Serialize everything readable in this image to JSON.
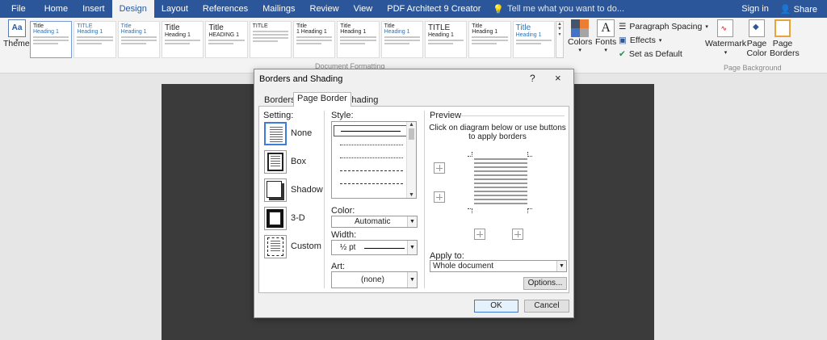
{
  "ribbon": {
    "tabs": [
      "File",
      "Home",
      "Insert",
      "Design",
      "Layout",
      "References",
      "Mailings",
      "Review",
      "View",
      "PDF Architect 9 Creator"
    ],
    "active_tab": "Design",
    "tell_me_placeholder": "Tell me what you want to do...",
    "sign_in": "Sign in",
    "share": "Share",
    "themes_label": "Themes",
    "style_thumbs": [
      {
        "title": "Title",
        "heading": "Heading 1"
      },
      {
        "title": "TITLE",
        "heading": "Heading 1"
      },
      {
        "title": "Title",
        "heading": "Heading 1"
      },
      {
        "title": "Title",
        "heading": "Heading 1"
      },
      {
        "title": "Title",
        "heading": "HEADING 1"
      },
      {
        "title": "TITLE",
        "heading": ""
      },
      {
        "title": "Title",
        "heading": "1 Heading 1"
      },
      {
        "title": "Title",
        "heading": "Heading 1"
      },
      {
        "title": "Title",
        "heading": "Heading 1"
      },
      {
        "title": "TITLE",
        "heading": "Heading 1"
      },
      {
        "title": "Title",
        "heading": "Heading 1"
      },
      {
        "title": "Title",
        "heading": "Heading 1"
      }
    ],
    "document_formatting_label": "Document Formatting",
    "colors_label": "Colors",
    "fonts_label": "Fonts",
    "paragraph_spacing": "Paragraph Spacing",
    "effects": "Effects",
    "set_as_default": "Set as Default",
    "watermark": "Watermark",
    "page_color": "Page Color",
    "page_borders": "Page Borders",
    "page_background_label": "Page Background"
  },
  "dialog": {
    "title": "Borders and Shading",
    "help": "?",
    "close": "×",
    "tabs": [
      "Borders",
      "Page Border",
      "Shading"
    ],
    "active_tab": "Page Border",
    "setting_label": "Setting:",
    "settings": [
      "None",
      "Box",
      "Shadow",
      "3-D",
      "Custom"
    ],
    "style_label": "Style:",
    "color_label": "Color:",
    "color_value": "Automatic",
    "width_label": "Width:",
    "width_value": "½ pt",
    "art_label": "Art:",
    "art_value": "(none)",
    "preview_label": "Preview",
    "preview_hint": "Click on diagram below or use buttons to apply borders",
    "apply_to_label": "Apply to:",
    "apply_to_value": "Whole document",
    "options": "Options...",
    "ok": "OK",
    "cancel": "Cancel"
  }
}
